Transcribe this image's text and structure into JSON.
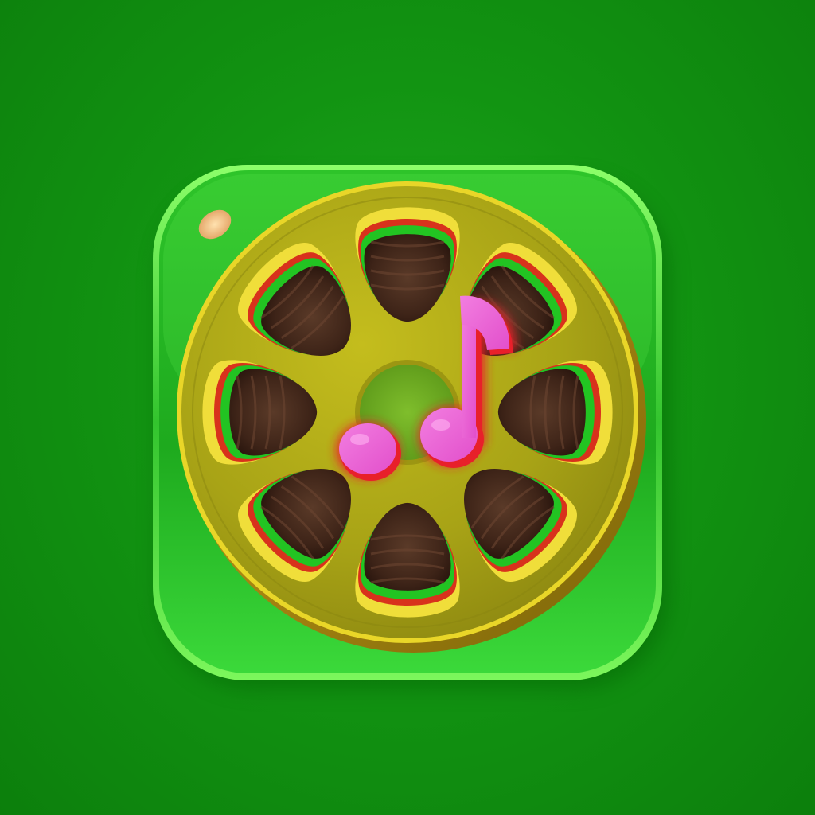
{
  "app_icon": {
    "icon_name": "film-reel-music-note-icon",
    "components": [
      "rounded-square-glass-tile-icon",
      "film-reel-icon",
      "music-note-icon"
    ]
  },
  "colors": {
    "background": "#129412",
    "tile_glass": "#2fcf2c",
    "tile_edge_glow": "#8cff5a",
    "reel_gold": "#b5b41a",
    "reel_gold_dark": "#7e7a0c",
    "reel_rim_highlight": "#f2e02e",
    "reel_hole_wood": "#4a2c1e",
    "note_pink": "#ee5fd6",
    "note_shadow_red": "#e8202a",
    "gloss_spot": "#f5c98a"
  }
}
